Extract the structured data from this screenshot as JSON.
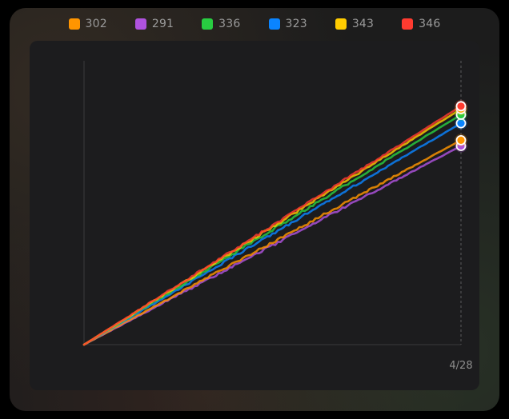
{
  "legend": [
    {
      "label": "302",
      "color": "#ff9500"
    },
    {
      "label": "291",
      "color": "#af52de"
    },
    {
      "label": "336",
      "color": "#28cd41"
    },
    {
      "label": "323",
      "color": "#0a84ff"
    },
    {
      "label": "343",
      "color": "#ffcc00"
    },
    {
      "label": "346",
      "color": "#ff3b30"
    }
  ],
  "chart_data": {
    "type": "line",
    "title": "",
    "xlabel": "",
    "ylabel": "",
    "x_tick_labels": [
      "4/28"
    ],
    "x": [
      0,
      1
    ],
    "ylim": [
      0,
      1
    ],
    "grid": false,
    "legend_position": "top",
    "series": [
      {
        "name": "302",
        "color": "#ff9500",
        "values": [
          0,
          0.72
        ]
      },
      {
        "name": "291",
        "color": "#af52de",
        "values": [
          0,
          0.7
        ]
      },
      {
        "name": "336",
        "color": "#28cd41",
        "values": [
          0,
          0.81
        ]
      },
      {
        "name": "323",
        "color": "#0a84ff",
        "values": [
          0,
          0.78
        ]
      },
      {
        "name": "343",
        "color": "#ffcc00",
        "values": [
          0,
          0.83
        ]
      },
      {
        "name": "346",
        "color": "#ff3b30",
        "values": [
          0,
          0.84
        ]
      }
    ]
  }
}
